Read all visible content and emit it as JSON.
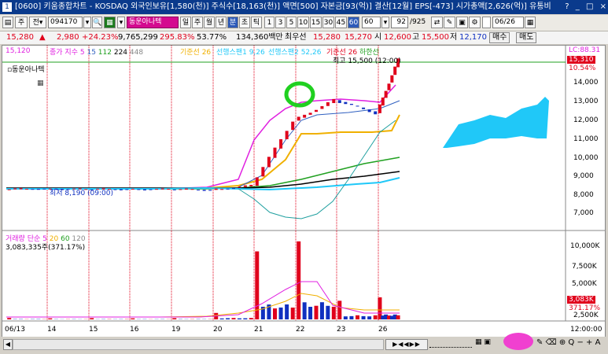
{
  "titlebar": {
    "icon_label": "1",
    "text": "[0600] 키움종합차트 - KOSDAQ 외국인보유[1,580(천)] 주식수[18,163(천)] 액면[500] 자본금[93(억)] 결산[12월] EPS[-473] 시가총액[2,626(억)] 유통비",
    "buttons": [
      "?",
      "_",
      "□",
      "×"
    ]
  },
  "toolbar": {
    "btn_ju": "주",
    "btn_jeon": "전",
    "code": "094170",
    "stock_name": "동운아나텍",
    "periods": [
      "일",
      "주",
      "월",
      "년",
      "분",
      "초",
      "틱"
    ],
    "selected_period": "분",
    "intervals": [
      "1",
      "3",
      "5",
      "10",
      "15",
      "30",
      "45",
      "60"
    ],
    "selected_interval": "60",
    "interval_value": "60",
    "count": "92",
    "total": "/925",
    "date": "06/26"
  },
  "pricebar": {
    "price": "15,280",
    "arrow": "▲",
    "change": "2,980",
    "change_pct": "+24.23%",
    "volume": "9,765,299",
    "vol_ratio": "295.83%",
    "turnover": "53.77%",
    "amount": "134,360백만",
    "high_label": "최우선",
    "bid1": "15,280",
    "bid2": "15,270",
    "open_label": "시",
    "open": "12,600",
    "hi_label": "고",
    "hi": "15,500",
    "lo_label": "저",
    "lo": "12,170",
    "buy_label": "매수",
    "sell_label": "매도"
  },
  "chart": {
    "lc_label": "LC:88.31",
    "top_value": "15,120",
    "legend_stock": "동운아나텍",
    "legend_ma_label": "종가 지수",
    "legend_ma": [
      "5",
      "15",
      "112",
      "224",
      "448"
    ],
    "legend_ichimoku": [
      "기준선 26",
      "선행스팬1 9,26",
      "선행스팬2 52,26",
      "기준선 26",
      "하한선"
    ],
    "annotation_high": "최고 15,500 (12:00)",
    "annotation_low": "최저 8,190 (09:00)",
    "price_marker": "15,310",
    "price_marker_pct": "10.54%",
    "yaxis": [
      "14,000",
      "13,000",
      "12,000",
      "11,000",
      "10,000",
      "9,000",
      "8,000",
      "7,000"
    ],
    "volume_legend_label": "거래량",
    "volume_legend_ma": [
      "단순",
      "5",
      "20",
      "60",
      "120"
    ],
    "volume_value": "3,083,335주(371.17%)",
    "vol_yaxis": [
      "10,000K",
      "7,500K",
      "5,000K",
      "2,500K"
    ],
    "vol_marker": "3,083K",
    "vol_marker_pct": "371.17%",
    "xaxis": [
      "06/13",
      "14",
      "15",
      "16",
      "19",
      "20",
      "21",
      "22",
      "23",
      "26"
    ],
    "time_label": "12:00:00"
  },
  "chart_data": {
    "type": "candlestick",
    "unit": "KRW",
    "title": "동운아나텍",
    "dates": [
      "06/13",
      "14",
      "15",
      "16",
      "19",
      "20",
      "21",
      "22",
      "23",
      "26"
    ],
    "ylim": [
      7000,
      15500
    ],
    "close_approx": [
      8350,
      8300,
      8320,
      8300,
      8280,
      8500,
      12000,
      13100,
      12400,
      15280
    ],
    "high": 15500,
    "low": 8190,
    "volume_k": [
      200,
      150,
      180,
      150,
      180,
      900,
      9500,
      10900,
      2600,
      3083
    ]
  },
  "colors": {
    "up": "#e0001b",
    "down": "#1030c0",
    "magenta": "#e020e0",
    "orange": "#f0b000",
    "green": "#20a020",
    "cyan": "#20c0f0"
  }
}
